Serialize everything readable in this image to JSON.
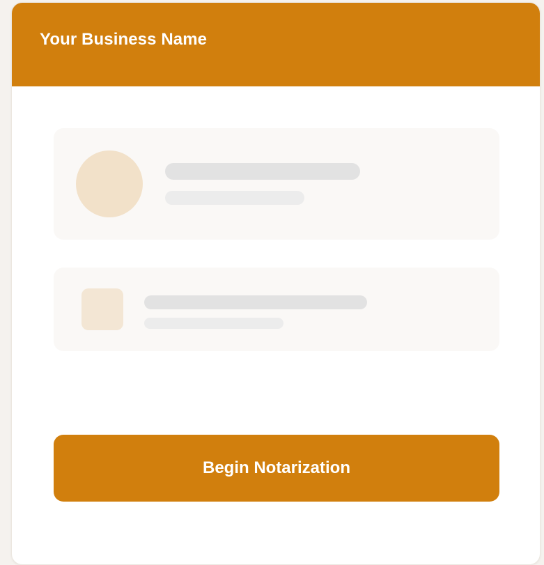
{
  "header": {
    "title": "Your Business Name"
  },
  "actions": {
    "primary_label": "Begin Notarization"
  },
  "colors": {
    "brand": "#d17f0d",
    "page_background": "#f5f2ee",
    "card_background": "#ffffff",
    "skeleton_panel": "#faf8f6",
    "skeleton_line_dark": "#e2e2e2",
    "skeleton_line_light": "#ececec",
    "skeleton_avatar": "#f2e1c9"
  }
}
